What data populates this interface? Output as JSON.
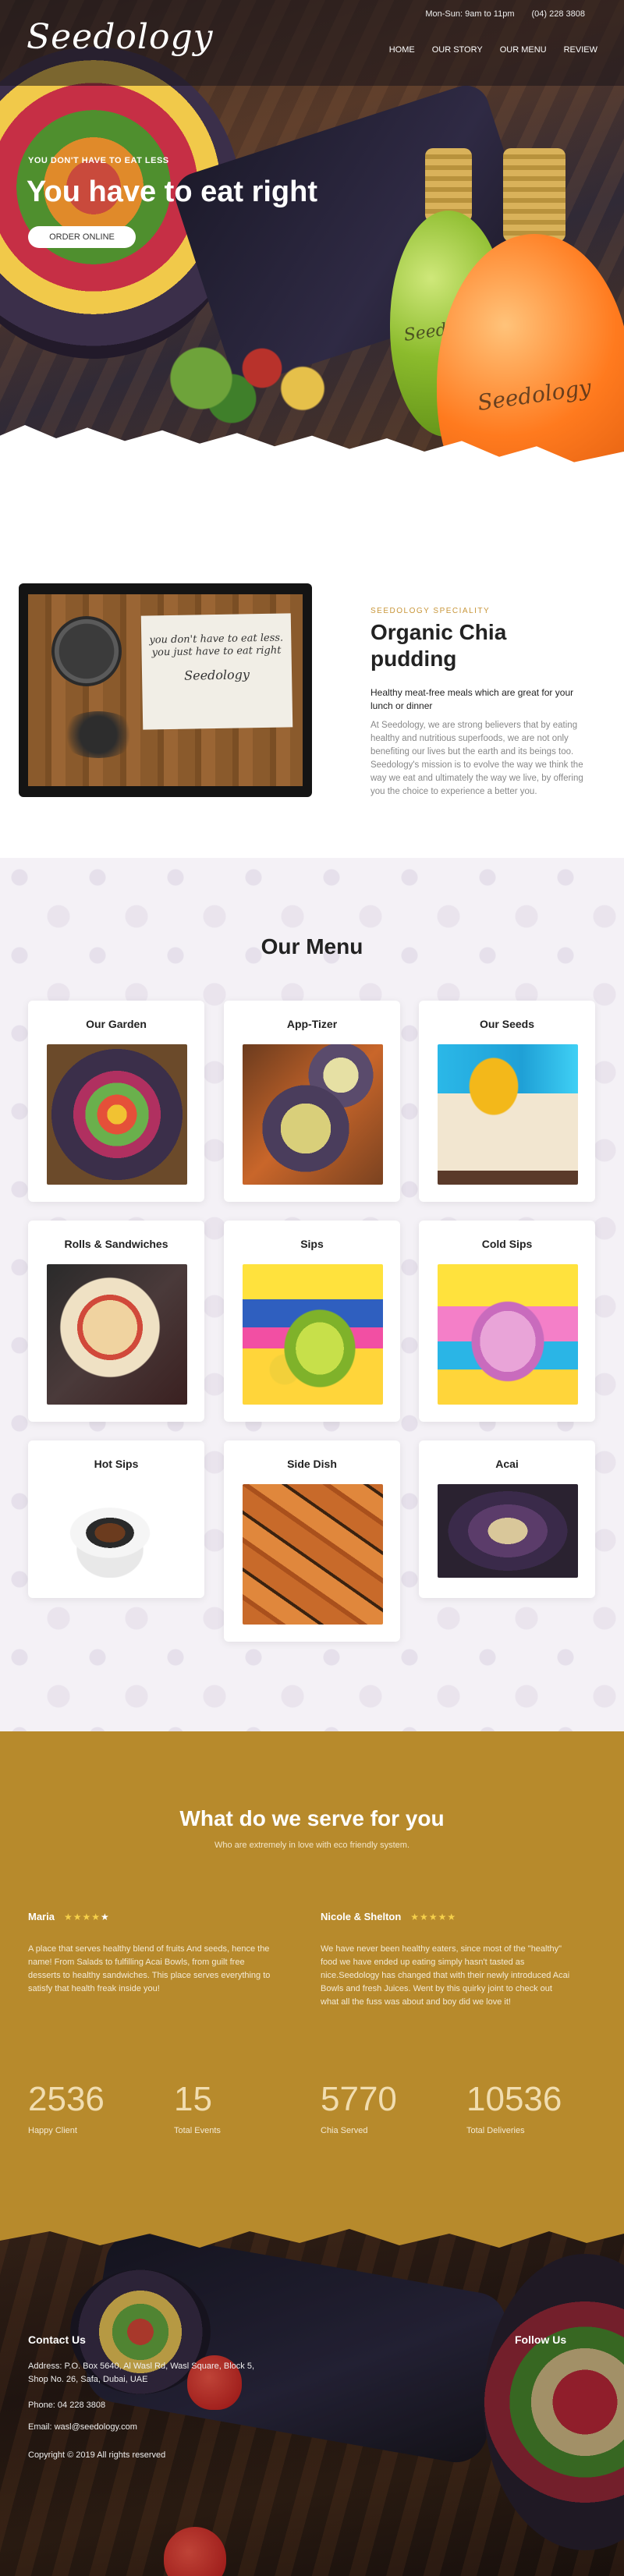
{
  "header": {
    "logo": "Seedology",
    "hours": "Mon-Sun: 9am to 11pm",
    "phone": "(04) 228 3808",
    "nav": [
      "HOME",
      "OUR STORY",
      "OUR MENU",
      "REVIEW"
    ]
  },
  "hero": {
    "kicker": "YOU DON'T HAVE TO EAT LESS",
    "title": "You have to eat right",
    "button": "ORDER ONLINE",
    "bottle_label": "Seedology"
  },
  "speciality": {
    "kicker": "SEEDOLOGY SPECIALITY",
    "title": "Organic Chia pudding",
    "subtitle": "Healthy meat-free meals which are great for your lunch or dinner",
    "body": "At Seedology, we are strong believers that by eating healthy and nutritious superfoods, we are not only benefiting our lives but the earth and its beings too. Seedology's mission is to evolve the way we think the way we eat and ultimately the way we live, by offering you the choice to experience a better you.",
    "note": "you don't have to eat less. you just have to eat right",
    "note_sig": "Seedology"
  },
  "menu": {
    "title": "Our Menu",
    "items": [
      {
        "label": "Our Garden"
      },
      {
        "label": "App-Tizer"
      },
      {
        "label": "Our Seeds"
      },
      {
        "label": "Rolls & Sandwiches"
      },
      {
        "label": "Sips"
      },
      {
        "label": "Cold Sips"
      },
      {
        "label": "Hot Sips"
      },
      {
        "label": "Side Dish"
      },
      {
        "label": "Acai"
      }
    ]
  },
  "serve": {
    "title": "What do we serve for you",
    "subtitle": "Who are extremely in love with eco friendly system.",
    "testimonials": [
      {
        "name": "Maria",
        "stars": "★★★★",
        "half_star": "★",
        "text": "A place that serves healthy blend of fruits And seeds, hence the name! From Salads to fulfilling Acai Bowls, from guilt free desserts to healthy sandwiches. This place serves everything to satisfy that health freak inside you!"
      },
      {
        "name": "Nicole & Shelton",
        "stars": "★★★★★",
        "text": "We have never been healthy eaters, since most of the \"healthy\" food we have ended up eating simply hasn't tasted as nice.Seedology has changed that with their newly introduced Acai Bowls and fresh Juices. Went by this quirky joint to check out what all the fuss was about and boy did we love it!"
      }
    ],
    "stats": [
      {
        "number": "2536",
        "label": "Happy Client"
      },
      {
        "number": "15",
        "label": "Total Events"
      },
      {
        "number": "5770",
        "label": "Chia Served"
      },
      {
        "number": "10536",
        "label": "Total Deliveries"
      }
    ]
  },
  "footer": {
    "contact_title": "Contact Us",
    "address": "Address: P.O. Box 5640, Al Wasl Rd, Wasl Square, Block 5, Shop No. 26, Safa, Dubai, UAE",
    "phone": "Phone: 04 228 3808",
    "email": "Email: wasl@seedology.com",
    "copyright": "Copyright © 2019 All rights reserved",
    "follow_title": "Follow Us"
  },
  "colors": {
    "accent": "#c8963a",
    "serve_bg": "#b78a2c",
    "star": "#f5d04a"
  }
}
